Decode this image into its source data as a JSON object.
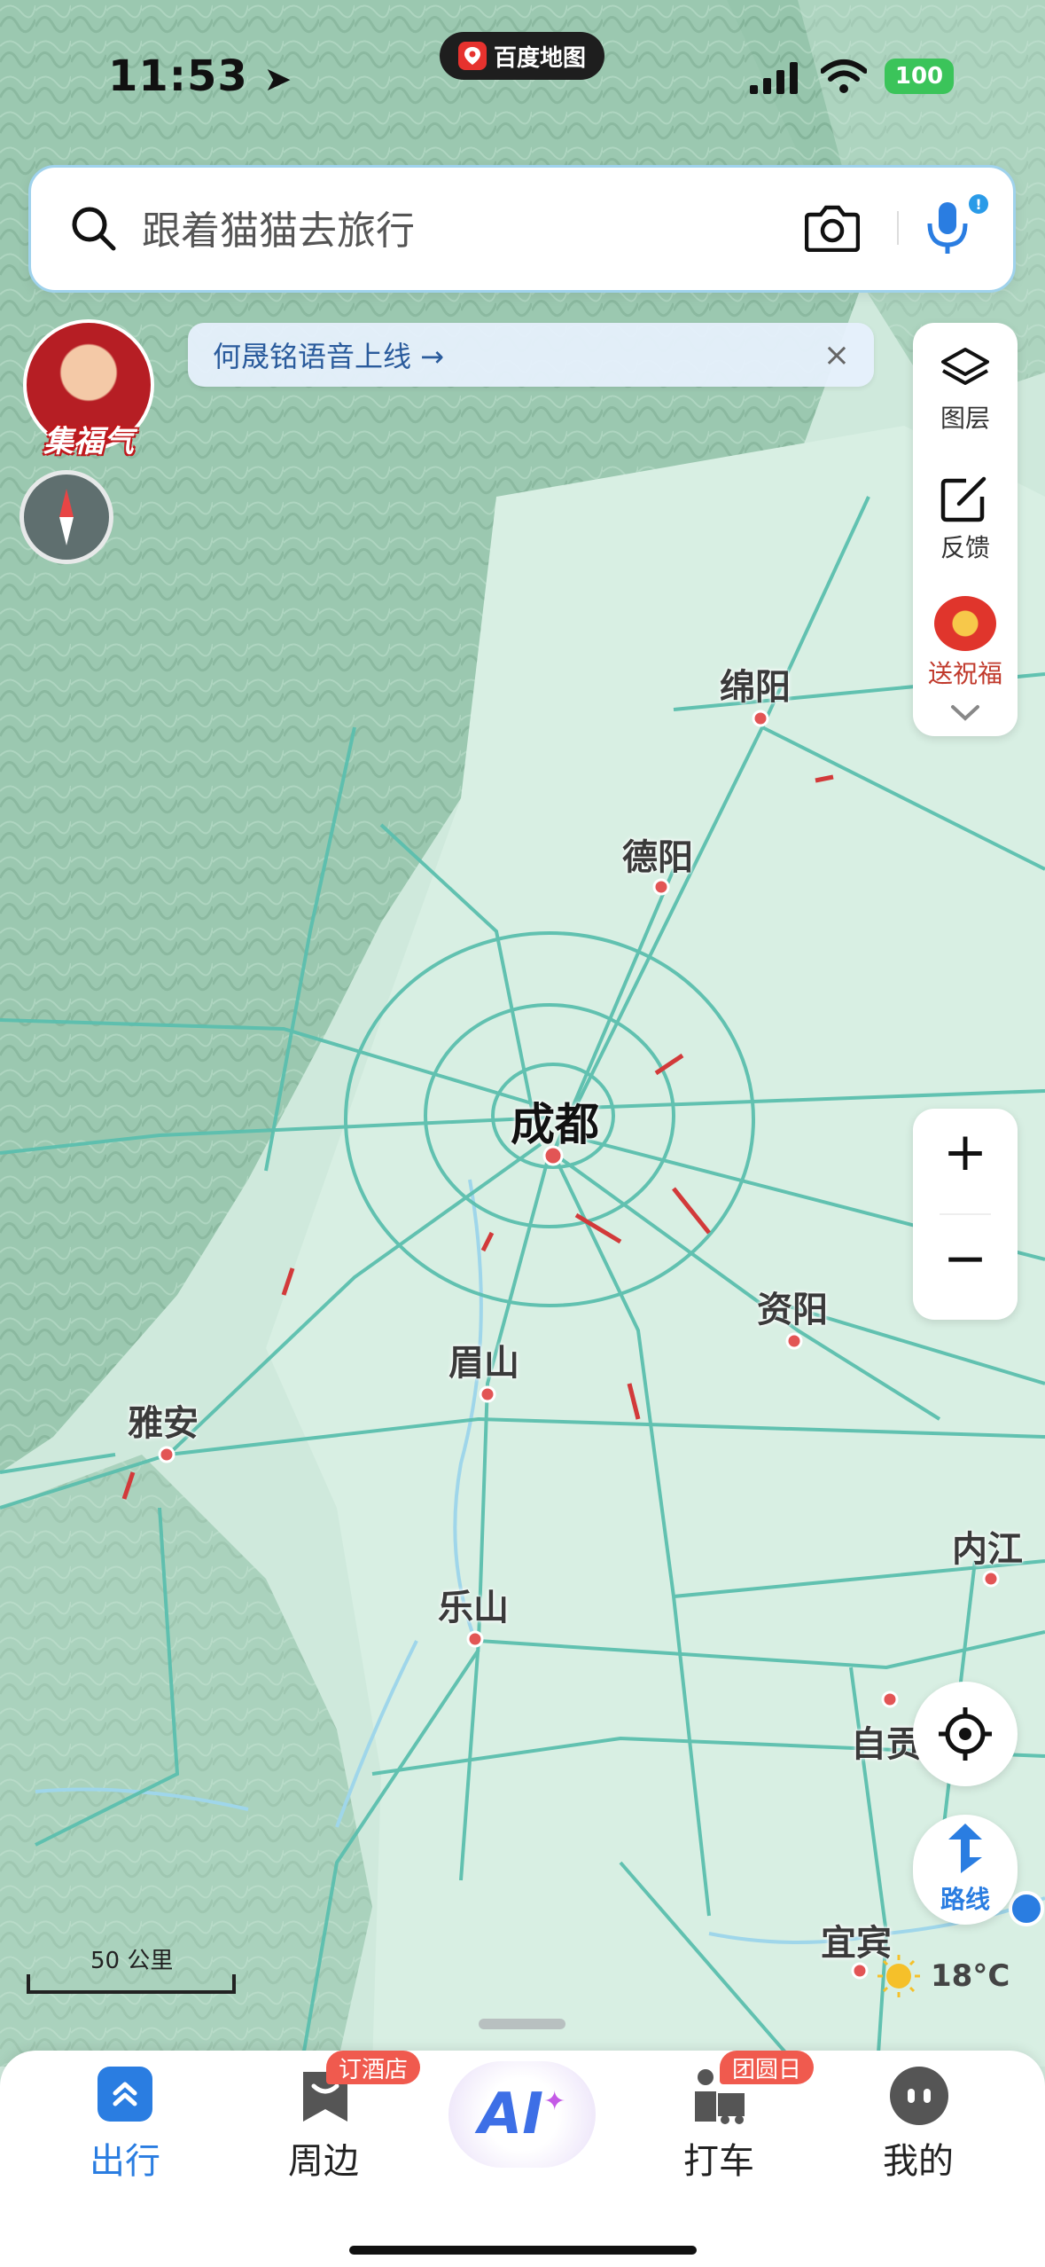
{
  "status": {
    "time": "11:53",
    "app_pill": "百度地图",
    "battery": "100"
  },
  "search": {
    "placeholder": "跟着猫猫去旅行"
  },
  "notice": {
    "text": "何晟铭语音上线 →",
    "close": "×"
  },
  "avatar": {
    "label": "集福气"
  },
  "side_panel": {
    "layers_label": "图层",
    "feedback_label": "反馈",
    "blessing_label": "送祝福"
  },
  "zoom": {
    "in": "+",
    "out": "−"
  },
  "route": {
    "label": "路线"
  },
  "map": {
    "cities": [
      "绵阳",
      "德阳",
      "成都",
      "资阳",
      "眉山",
      "雅安",
      "乐山",
      "内江",
      "自贡",
      "宜宾"
    ],
    "scale_label": "50 公里",
    "weather": "18°C"
  },
  "nav": {
    "items": [
      {
        "label": "出行",
        "active": true
      },
      {
        "label": "周边",
        "badge": "订酒店"
      },
      {
        "label": "AI"
      },
      {
        "label": "打车",
        "badge": "团圆日"
      },
      {
        "label": "我的"
      }
    ]
  },
  "colors": {
    "accent": "#2a7de1",
    "road": "#5bbfae",
    "traffic_red": "#d23a3a",
    "land": "#cfe9dc",
    "mountain": "#8fbfa6"
  }
}
